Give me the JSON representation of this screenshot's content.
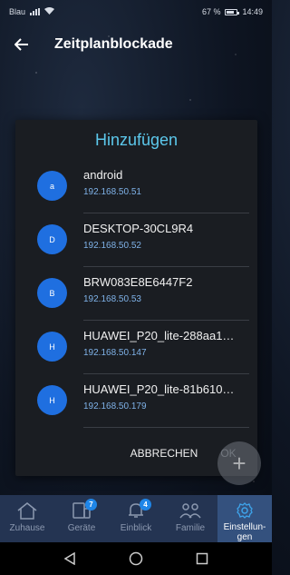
{
  "statusbar": {
    "carrier": "Blau",
    "battery": "67 %",
    "time": "14:49"
  },
  "header": {
    "title": "Zeitplanblockade"
  },
  "dialog": {
    "title": "Hinzufügen",
    "devices": [
      {
        "initial": "a",
        "name": "android",
        "ip": "192.168.50.51"
      },
      {
        "initial": "D",
        "name": "DESKTOP-30CL9R4",
        "ip": "192.168.50.52"
      },
      {
        "initial": "B",
        "name": "BRW083E8E6447F2",
        "ip": "192.168.50.53"
      },
      {
        "initial": "H",
        "name": "HUAWEI_P20_lite-288aa1…",
        "ip": "192.168.50.147"
      },
      {
        "initial": "H",
        "name": "HUAWEI_P20_lite-81b610…",
        "ip": "192.168.50.179"
      }
    ],
    "cancel_label": "ABBRECHEN",
    "ok_label": "OK"
  },
  "fab": {
    "icon": "plus-icon"
  },
  "tabs": [
    {
      "label": "Zuhause",
      "icon": "house-icon"
    },
    {
      "label": "Geräte",
      "icon": "devices-icon",
      "badge": "7"
    },
    {
      "label": "Einblick",
      "icon": "bell-icon",
      "badge": "4"
    },
    {
      "label": "Familie",
      "icon": "family-icon"
    },
    {
      "label": "Einstellun-\ngen",
      "icon": "gear-icon",
      "active": true
    }
  ],
  "colors": {
    "accent": "#5cc8ec",
    "avatar": "#1f6fe0",
    "tabbar": "#243452",
    "active_tab": "#34517e"
  }
}
